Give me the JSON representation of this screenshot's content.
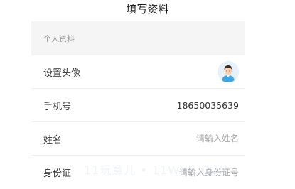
{
  "header": {
    "title": "填写资料"
  },
  "section": {
    "title": "个人资料"
  },
  "rows": {
    "avatar": {
      "label": "设置头像",
      "icon": "user-avatar-icon"
    },
    "phone": {
      "label": "手机号",
      "value": "18650035639"
    },
    "name": {
      "label": "姓名",
      "placeholder": "请输入姓名"
    },
    "id_card": {
      "label": "身份证",
      "placeholder": "请输入身份证号"
    }
  },
  "watermark": "11玩意儿 • 11WYX.COM",
  "colors": {
    "section_bg": "#f5f5f5",
    "avatar_bg": "#e7f1f9",
    "shirt": "#42a5e0"
  }
}
